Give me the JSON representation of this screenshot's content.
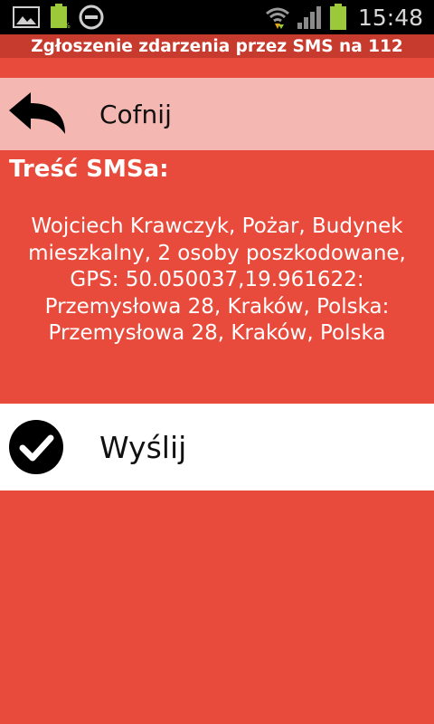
{
  "status_bar": {
    "battery_percent": "100%",
    "time": "15:48",
    "icons": [
      "gallery-icon",
      "battery-charging-icon",
      "do-not-disturb-icon",
      "wifi-icon",
      "signal-icon",
      "battery-icon"
    ]
  },
  "header": {
    "title": "Zgłoszenie zdarzenia przez SMS na 112"
  },
  "back": {
    "label": "Cofnij",
    "icon": "back-arrow-icon"
  },
  "sms": {
    "heading": "Treść SMSa:",
    "content": "Wojciech Krawczyk, Pożar, Budynek mieszkalny, 2 osoby poszkodowane, GPS: 50.050037,19.961622: Przemysłowa 28, Kraków, Polska: Przemysłowa 28, Kraków, Polska"
  },
  "send": {
    "label": "Wyślij",
    "icon": "check-circle-icon"
  },
  "colors": {
    "background": "#e84b3c",
    "title_bar": "#c73a2e",
    "back_row": "#f5b7b1",
    "send_row": "#ffffff"
  }
}
